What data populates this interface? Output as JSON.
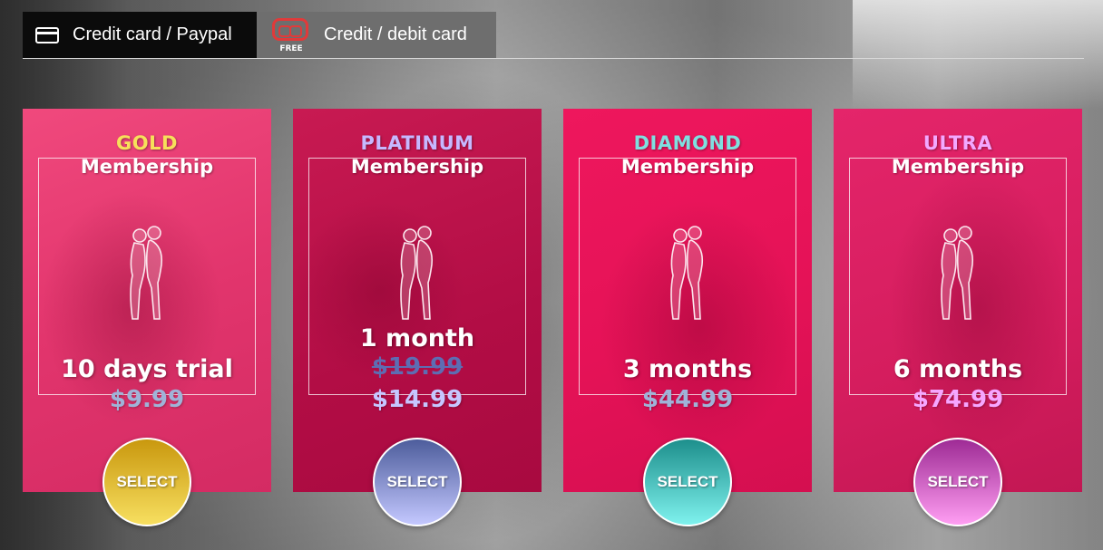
{
  "tabs": [
    {
      "label": "Credit card / Paypal",
      "icon": "credit-card-icon",
      "active": true
    },
    {
      "label": "Credit / debit card",
      "icon": "vr-headset-icon",
      "badge": "FREE",
      "active": false
    }
  ],
  "membership_word": "Membership",
  "select_label": "SELECT",
  "plans": [
    {
      "tier": "GOLD",
      "tier_color": "#f7e05a",
      "duration": "10 days trial",
      "price": "$9.99",
      "price_color": "#9fb3d8",
      "button_colors": [
        "#c9980e",
        "#f7df60"
      ]
    },
    {
      "tier": "PLATINUM",
      "tier_color": "#c6b8ff",
      "duration": "1 month",
      "old_price": "$19.99",
      "price": "$14.99",
      "price_color": "#c6c6ff",
      "button_colors": [
        "#4d5d9c",
        "#c4c8ff"
      ]
    },
    {
      "tier": "DIAMOND",
      "tier_color": "#7fe0e0",
      "duration": "3 months",
      "price": "$44.99",
      "price_color": "#9fb3d8",
      "button_colors": [
        "#1d8f8c",
        "#7ff2ee"
      ]
    },
    {
      "tier": "ULTRA",
      "tier_color": "#f3a8ff",
      "duration": "6 months",
      "price": "$74.99",
      "price_color": "#f6a6ff",
      "button_colors": [
        "#9e2b95",
        "#ff9ef2"
      ]
    }
  ]
}
